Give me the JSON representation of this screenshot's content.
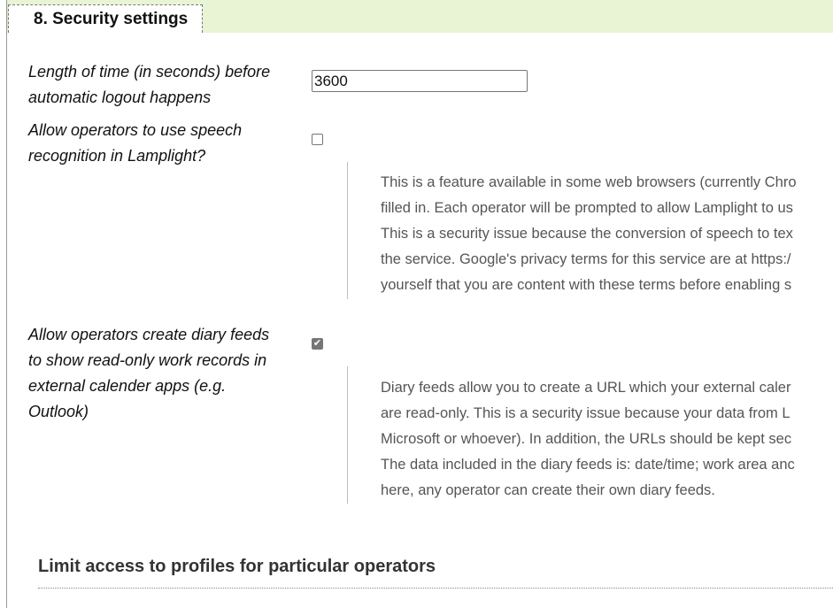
{
  "section": {
    "title": "8. Security settings"
  },
  "settings": {
    "logout": {
      "label_lines": [
        "Length of time (in seconds) before",
        "automatic logout happens"
      ],
      "value": "3600"
    },
    "speech": {
      "label_lines": [
        "Allow operators to use speech",
        "recognition in Lamplight?"
      ],
      "checked": false,
      "help_lines": [
        "This is a feature available in some web browsers (currently Chro",
        "filled in. Each operator will be prompted to allow Lamplight to us",
        "This is a security issue because the conversion of speech to tex",
        "the service. Google's privacy terms for this service are at https:/",
        "yourself that you are content with these terms before enabling s"
      ]
    },
    "diary": {
      "label_lines": [
        "Allow operators create diary feeds",
        "to show read-only work records in",
        "external calender apps (e.g.",
        "Outlook)"
      ],
      "checked": true,
      "help_lines": [
        "Diary feeds allow you to create a URL which your external caler",
        "are read-only. This is a security issue because your data from L",
        "Microsoft or whoever). In addition, the URLs should be kept sec",
        "The data included in the diary feeds is: date/time; work area anc",
        "here, any operator can create their own diary feeds."
      ]
    }
  },
  "subsection": {
    "title": "Limit access to profiles for particular operators"
  }
}
